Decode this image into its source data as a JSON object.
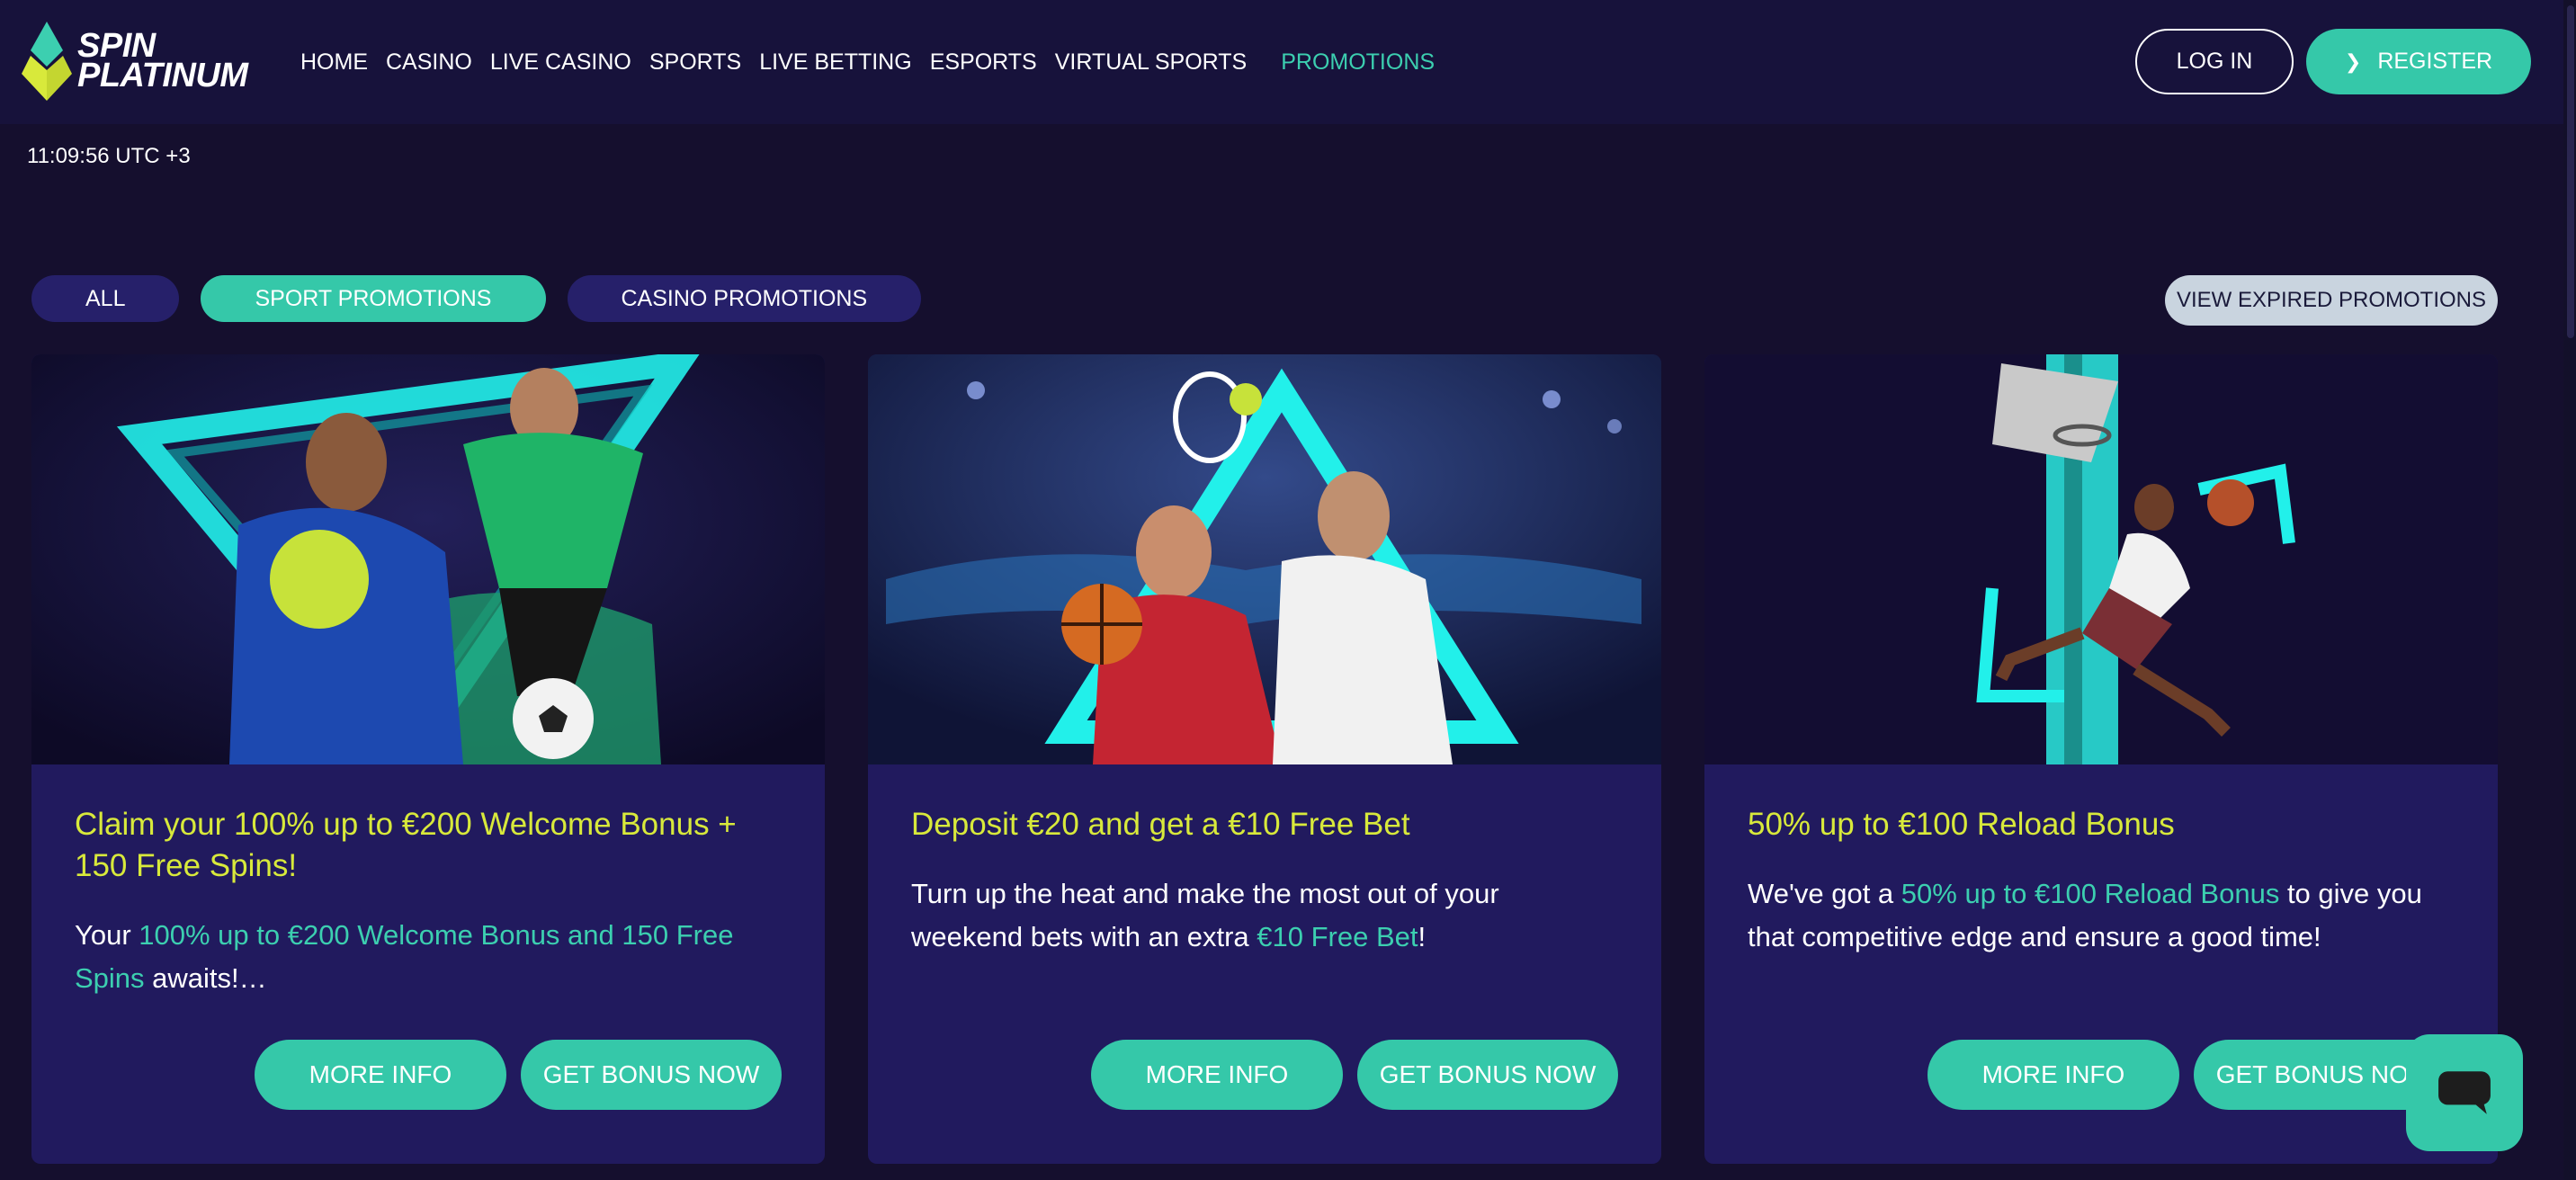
{
  "brand": {
    "line1": "SPIN",
    "line2": "PLATINUM"
  },
  "nav": [
    {
      "label": "HOME"
    },
    {
      "label": "CASINO"
    },
    {
      "label": "LIVE CASINO"
    },
    {
      "label": "SPORTS"
    },
    {
      "label": "LIVE BETTING"
    },
    {
      "label": "ESPORTS"
    },
    {
      "label": "VIRTUAL SPORTS"
    },
    {
      "label": "PROMOTIONS"
    }
  ],
  "auth": {
    "login": "LOG IN",
    "register": "REGISTER"
  },
  "clock": "11:09:56 UTC +3",
  "filters": [
    {
      "label": "ALL"
    },
    {
      "label": "SPORT PROMOTIONS",
      "selected": true
    },
    {
      "label": "CASINO PROMOTIONS"
    }
  ],
  "expired_button": "VIEW EXPIRED PROMOTIONS",
  "cards": [
    {
      "title": "Claim your 100% up to €200 Welcome Bonus + 150 Free Spins!",
      "desc_before": "Your ",
      "desc_highlight": "100% up to €200 Welcome Bonus and 150 Free Spins",
      "desc_after": " awaits!…",
      "more": "MORE INFO",
      "bonus": "GET BONUS NOW"
    },
    {
      "title": "Deposit €20 and get a €10 Free Bet",
      "desc_before": "Turn up the heat and make the most out of your weekend bets with an extra ",
      "desc_highlight": "€10 Free Bet",
      "desc_after": "!",
      "more": "MORE INFO",
      "bonus": "GET BONUS NOW"
    },
    {
      "title": "50% up to €100 Reload Bonus",
      "desc_before": "We've got a ",
      "desc_highlight": "50% up to €100 Reload Bonus",
      "desc_after": " to give you that competitive edge and ensure a good time!",
      "more": "MORE INFO",
      "bonus": "GET BONUS NOW"
    }
  ],
  "colors": {
    "accent": "#35c8a9",
    "title_yellow": "#d8e93b",
    "card_bg": "#211a5e",
    "page_bg": "#150f2e",
    "header_bg": "#17123b"
  },
  "icons": {
    "logo": "diamond-logo-icon",
    "register": "chevron-right-icon",
    "chat": "chat-bubble-icon"
  }
}
